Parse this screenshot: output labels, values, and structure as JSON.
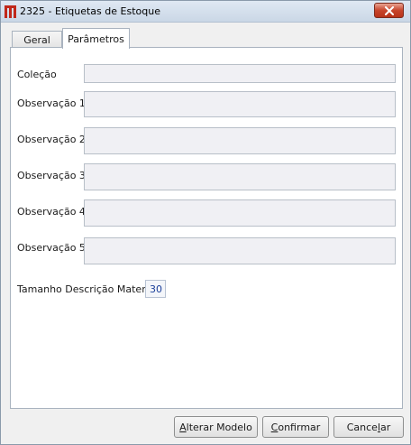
{
  "window": {
    "title": "2325 - Etiquetas de Estoque",
    "icon": "app-logo-icon",
    "close_icon": "close-icon"
  },
  "tabs": [
    {
      "label": "Geral",
      "active": false
    },
    {
      "label": "Parâmetros",
      "active": true
    }
  ],
  "form": {
    "fields": [
      {
        "label": "Coleção",
        "value": ""
      },
      {
        "label": "Observação 1",
        "value": ""
      },
      {
        "label": "Observação 2",
        "value": ""
      },
      {
        "label": "Observação 3",
        "value": ""
      },
      {
        "label": "Observação 4",
        "value": ""
      },
      {
        "label": "Observação 5",
        "value": ""
      }
    ],
    "tamanho_label": "Tamanho Descrição Material",
    "tamanho_value": "30"
  },
  "buttons": {
    "alterar_modelo": {
      "label": "Alterar Modelo",
      "mnemonic": "A"
    },
    "confirmar": {
      "label": "Confirmar",
      "mnemonic": "C"
    },
    "cancelar": {
      "label": "Cancelar",
      "mnemonic": "l"
    }
  },
  "colors": {
    "title_bar": "#cad7e6",
    "close_button": "#c7442b",
    "field_bg": "#f0f0f4",
    "number_text": "#1b3f9a"
  }
}
